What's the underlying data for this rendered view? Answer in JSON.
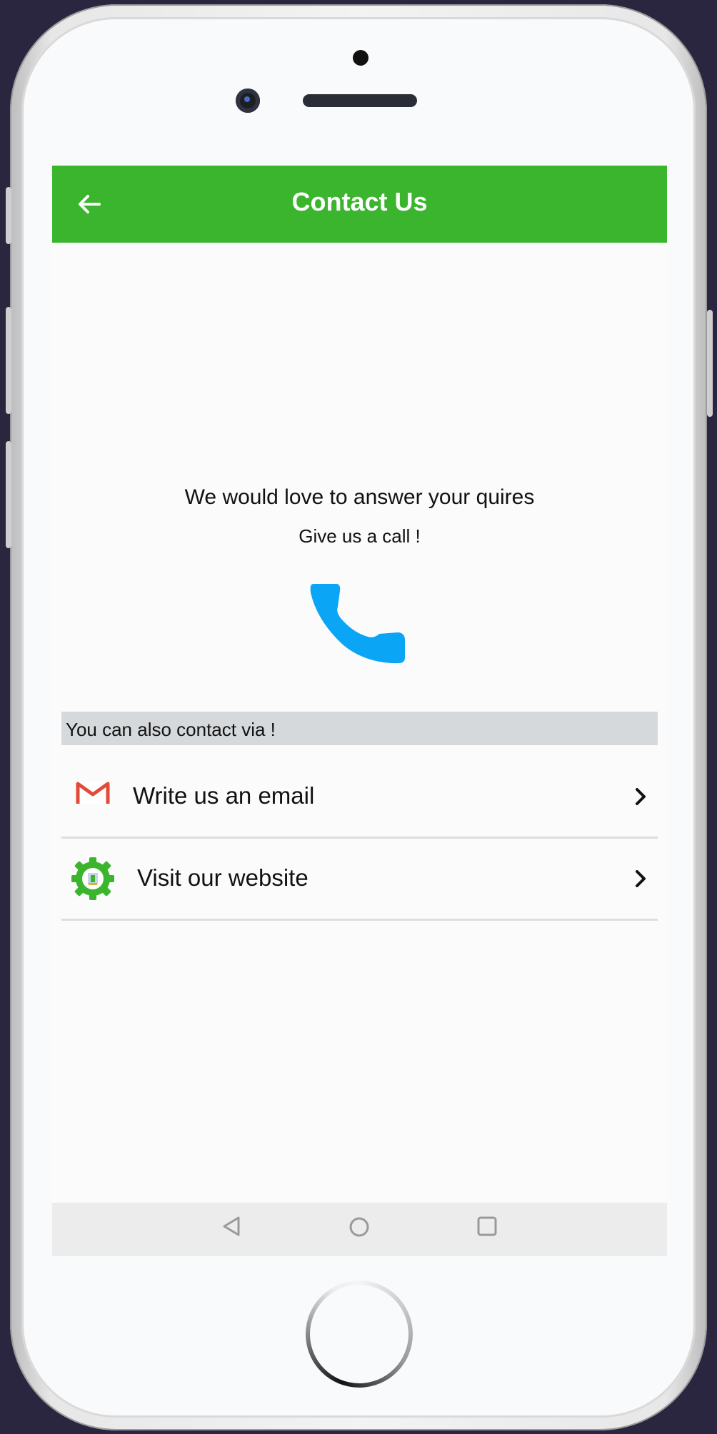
{
  "app_bar": {
    "title": "Contact Us",
    "color": "#3bb52e"
  },
  "main": {
    "headline": "We would love to answer your quires",
    "subline": "Give us a call !",
    "call_icon": "phone-icon",
    "call_icon_color": "#0aa6f5"
  },
  "contact_section": {
    "label": "You can also contact via !",
    "items": [
      {
        "label": "Write us an email",
        "icon": "gmail-icon"
      },
      {
        "label": "Visit our website",
        "icon": "website-gear-icon"
      }
    ]
  },
  "navigation": {
    "buttons": [
      "back-triangle-icon",
      "home-circle-icon",
      "recents-square-icon"
    ]
  }
}
